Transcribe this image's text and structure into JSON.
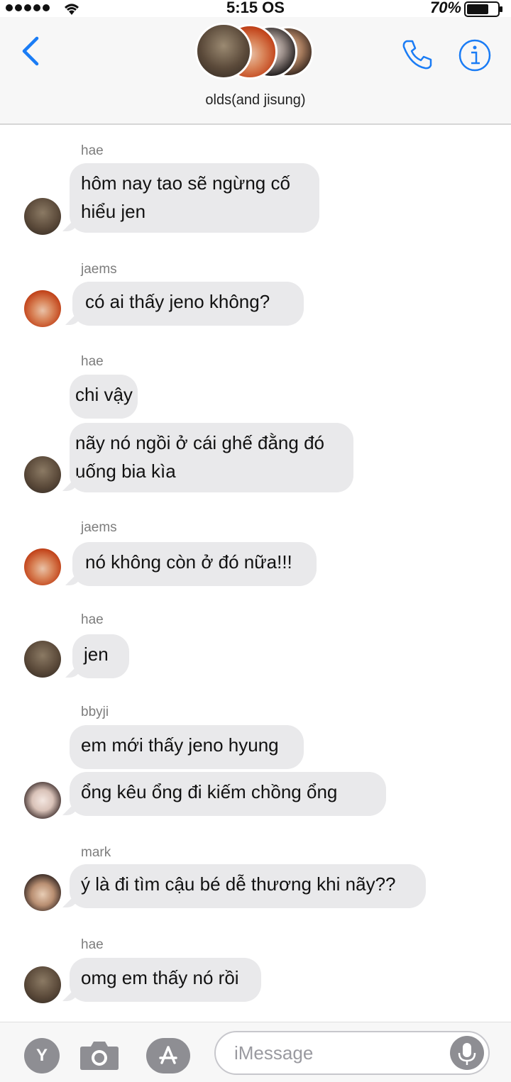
{
  "status_bar": {
    "time": "5:15 OS",
    "battery": "70%"
  },
  "header": {
    "group_name": "olds(and jisung)"
  },
  "messages": [
    {
      "sender": "hae",
      "bubbles": [
        {
          "lines": [
            "hôm nay tao sẽ ngừng cố",
            "hiểu jen"
          ]
        }
      ]
    },
    {
      "sender": "jaems",
      "bubbles": [
        {
          "lines": [
            "có ai thấy jeno không?"
          ]
        }
      ]
    },
    {
      "sender": "hae",
      "bubbles": [
        {
          "lines": [
            "chi vậy"
          ]
        },
        {
          "lines": [
            "nãy nó ngồi ở cái ghế đằng đó",
            "uống bia kìa"
          ]
        }
      ]
    },
    {
      "sender": "jaems",
      "bubbles": [
        {
          "lines": [
            "nó không còn ở đó nữa!!!"
          ]
        }
      ]
    },
    {
      "sender": "hae",
      "bubbles": [
        {
          "lines": [
            "jen"
          ]
        }
      ]
    },
    {
      "sender": "bbyji",
      "bubbles": [
        {
          "lines": [
            "em mới thấy jeno hyung"
          ]
        },
        {
          "lines": [
            "ổng kêu ổng đi kiếm chồng ổng"
          ]
        }
      ]
    },
    {
      "sender": "mark",
      "bubbles": [
        {
          "lines": [
            "ý là đi tìm cậu bé dễ thương khi nãy??"
          ]
        }
      ]
    },
    {
      "sender": "hae",
      "bubbles": [
        {
          "lines": [
            "omg em thấy nó rồi"
          ]
        }
      ]
    }
  ],
  "composer": {
    "placeholder": "iMessage",
    "apps_button": "Y"
  }
}
